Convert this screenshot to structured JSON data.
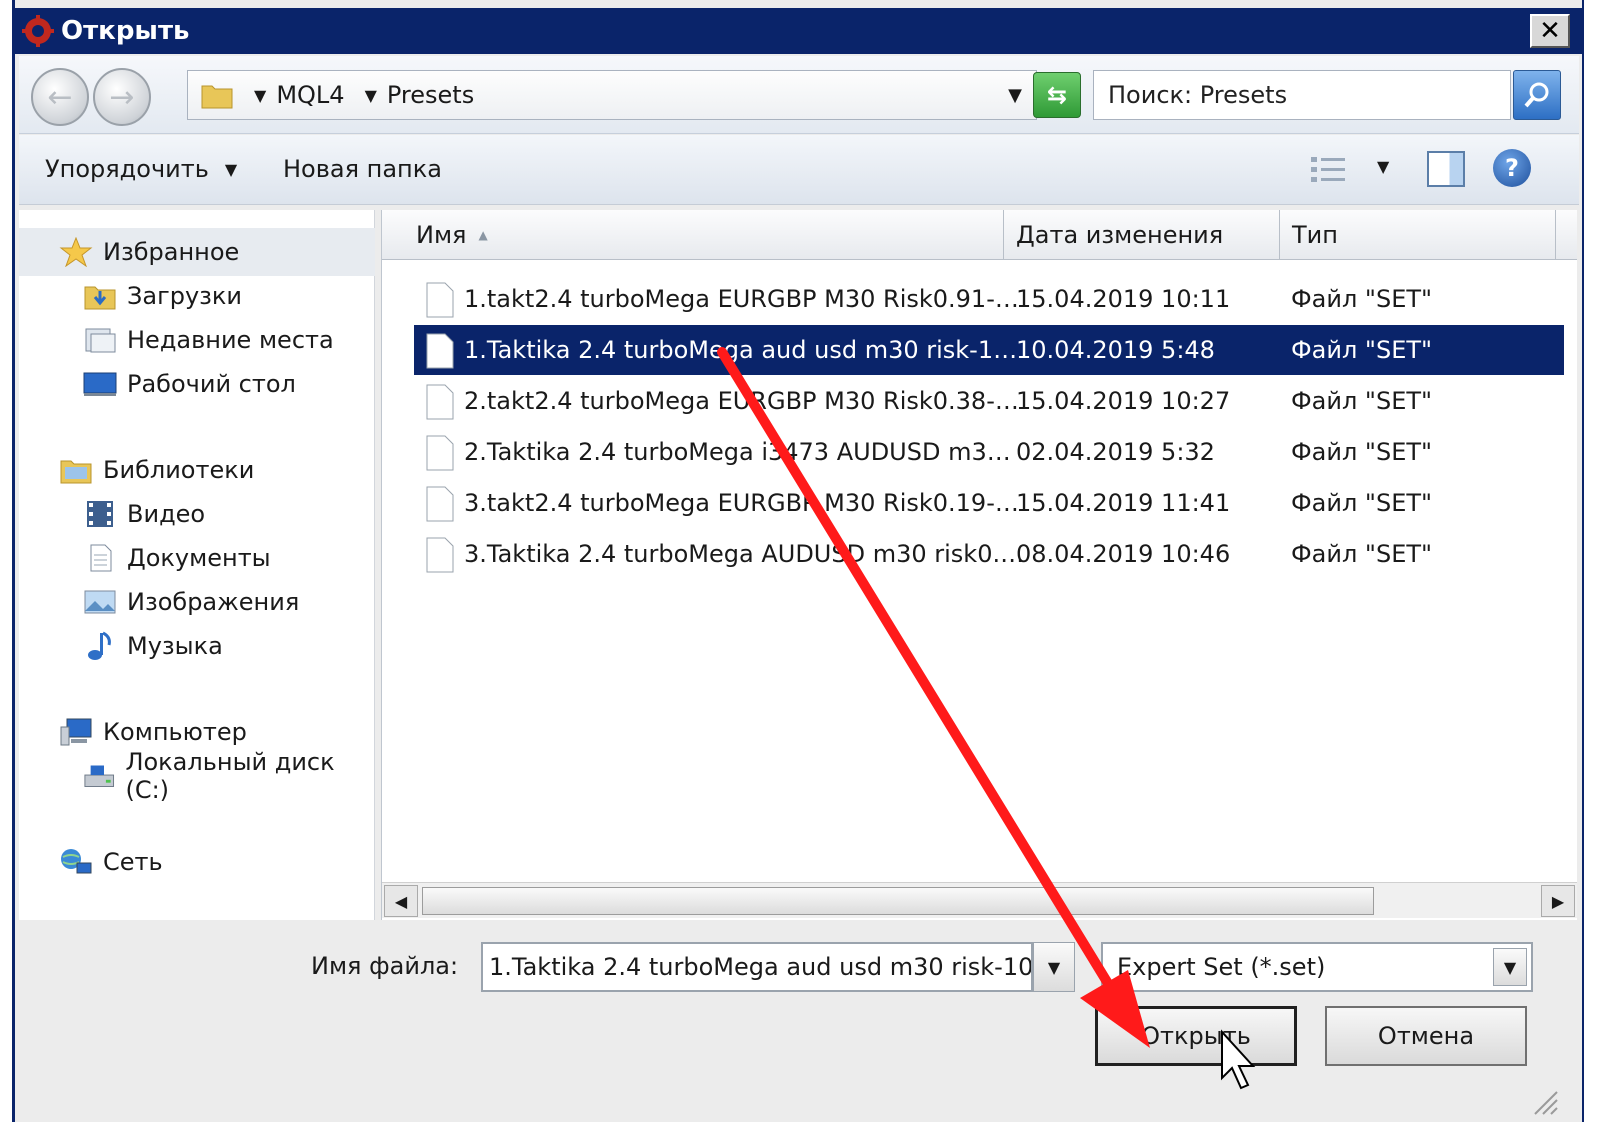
{
  "window": {
    "title": "Открыть",
    "close_label": "✕"
  },
  "address": {
    "crumbs": [
      "MQL4",
      "Presets"
    ],
    "search_placeholder": "Поиск: Presets"
  },
  "toolbar": {
    "organize": "Упорядочить",
    "new_folder": "Новая папка",
    "help": "?"
  },
  "sidebar": {
    "favorites": "Избранное",
    "downloads": "Загрузки",
    "recent": "Недавние места",
    "desktop": "Рабочий стол",
    "libraries": "Библиотеки",
    "video": "Видео",
    "documents": "Документы",
    "images": "Изображения",
    "music": "Музыка",
    "computer": "Компьютер",
    "local_disk": "Локальный диск (C:)",
    "network": "Сеть"
  },
  "columns": {
    "name": "Имя",
    "date": "Дата изменения",
    "type": "Тип"
  },
  "files": [
    {
      "name": "1.takt2.4 turboMega EURGBP M30 Risk0.91-…",
      "date": "15.04.2019 10:11",
      "type": "Файл \"SET\""
    },
    {
      "name": "1.Taktika 2.4 turboMega aud usd m30 risk-1…",
      "date": "10.04.2019 5:48",
      "type": "Файл \"SET\"",
      "selected": true
    },
    {
      "name": "2.takt2.4 turboMega EURGBP M30 Risk0.38-…",
      "date": "15.04.2019 10:27",
      "type": "Файл \"SET\""
    },
    {
      "name": "2.Taktika 2.4 turboMega  i3473 AUDUSD m3…",
      "date": "02.04.2019 5:32",
      "type": "Файл \"SET\""
    },
    {
      "name": "3.takt2.4 turboMega EURGBP M30 Risk0.19-…",
      "date": "15.04.2019 11:41",
      "type": "Файл \"SET\""
    },
    {
      "name": "3.Taktika 2.4 turboMega AUDUSD m30 risk0.…",
      "date": "08.04.2019 10:46",
      "type": "Файл \"SET\""
    }
  ],
  "bottom": {
    "filename_label": "Имя файла:",
    "filename_value": "1.Taktika 2.4 turboMega aud usd m30 risk-10",
    "filetype_value": "Expert Set (*.set)",
    "open_button": "Открыть",
    "cancel_button": "Отмена"
  },
  "colors": {
    "titlebar": "#0a246a",
    "selection": "#0a246a",
    "annotation_arrow": "#ff1a1a"
  }
}
